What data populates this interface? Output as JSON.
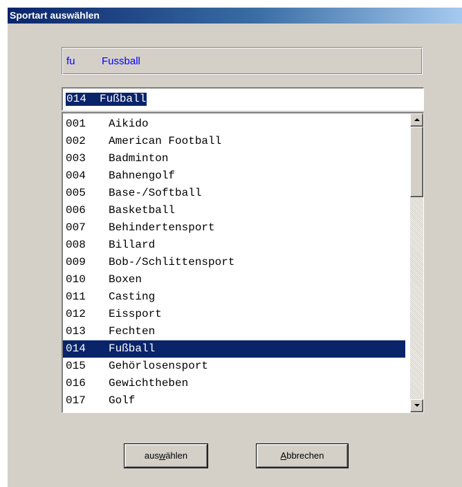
{
  "window": {
    "title": "Sportart auswählen"
  },
  "current_selection": {
    "code": "fu",
    "name": "Fussball"
  },
  "edit_field": {
    "value": "014  Fußball"
  },
  "list": {
    "items": [
      {
        "code": "001",
        "name": "Aikido"
      },
      {
        "code": "002",
        "name": "American Football"
      },
      {
        "code": "003",
        "name": "Badminton"
      },
      {
        "code": "004",
        "name": "Bahnengolf"
      },
      {
        "code": "005",
        "name": "Base-/Softball"
      },
      {
        "code": "006",
        "name": "Basketball"
      },
      {
        "code": "007",
        "name": "Behindertensport"
      },
      {
        "code": "008",
        "name": "Billard"
      },
      {
        "code": "009",
        "name": "Bob-/Schlittensport"
      },
      {
        "code": "010",
        "name": "Boxen"
      },
      {
        "code": "011",
        "name": "Casting"
      },
      {
        "code": "012",
        "name": "Eissport"
      },
      {
        "code": "013",
        "name": "Fechten"
      },
      {
        "code": "014",
        "name": "Fußball"
      },
      {
        "code": "015",
        "name": "Gehörlosensport"
      },
      {
        "code": "016",
        "name": "Gewichtheben"
      },
      {
        "code": "017",
        "name": "Golf"
      }
    ],
    "selected_index": 13
  },
  "buttons": {
    "select": {
      "pre": "aus",
      "mnemonic": "w",
      "post": "ählen"
    },
    "cancel": {
      "pre": "",
      "mnemonic": "A",
      "post": "bbrechen"
    }
  },
  "colors": {
    "dialog_background": "#d4d0c8",
    "title_gradient_start": "#0a246a",
    "selection_highlight": "#0a246a",
    "current_selection_text": "#0000ff"
  },
  "icons": {
    "scroll_up": "arrow-up-icon",
    "scroll_down": "arrow-down-icon"
  }
}
